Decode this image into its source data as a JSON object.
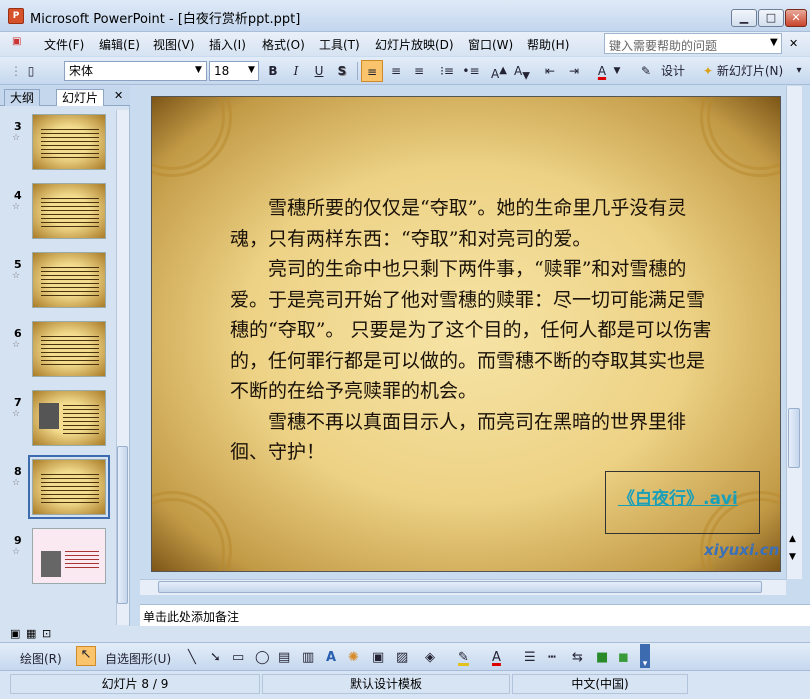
{
  "window": {
    "title": "Microsoft PowerPoint - [白夜行赏析ppt.ppt]",
    "app_icon": "P"
  },
  "menu": {
    "items": [
      "文件(F)",
      "编辑(E)",
      "视图(V)",
      "插入(I)",
      "格式(O)",
      "工具(T)",
      "幻灯片放映(D)",
      "窗口(W)",
      "帮助(H)"
    ],
    "help_placeholder": "键入需要帮助的问题"
  },
  "toolbar": {
    "font": "宋体",
    "size": "18",
    "bold": "B",
    "italic": "I",
    "underline": "U",
    "shadow": "S",
    "design_label": "设计(S)",
    "new_slide_label": "新幻灯片(N)"
  },
  "left_panel": {
    "tab_outline": "大纲",
    "tab_slides": "幻灯片",
    "close": "✕",
    "thumbnails": [
      {
        "num": "3"
      },
      {
        "num": "4"
      },
      {
        "num": "5"
      },
      {
        "num": "6"
      },
      {
        "num": "7"
      },
      {
        "num": "8"
      },
      {
        "num": "9"
      }
    ],
    "selected": "8"
  },
  "slide": {
    "paragraphs": [
      "雪穗所要的仅仅是“夺取”。她的生命里几乎没有灵魂，只有两样东西：“夺取”和对亮司的爱。",
      "亮司的生命中也只剩下两件事，“赎罪”和对雪穗的爱。于是亮司开始了他对雪穗的赎罪：尽一切可能满足雪穗的“夺取”。 只要是为了这个目的，任何人都是可以伤害的，任何罪行都是可以做的。而雪穗不断的夺取其实也是不断的在给予亮赎罪的机会。",
      "雪穗不再以真面目示人，而亮司在黑暗的世界里徘徊、守护！"
    ],
    "link": "《白夜行》.avi",
    "watermark": "xiyuxi.cn"
  },
  "notes": {
    "placeholder": "单击此处添加备注"
  },
  "drawing": {
    "draw_label": "绘图(R)",
    "autoshapes_label": "自选图形(U)"
  },
  "status": {
    "slide": "幻灯片 8 / 9",
    "template": "默认设计模板",
    "language": "中文(中国)"
  }
}
